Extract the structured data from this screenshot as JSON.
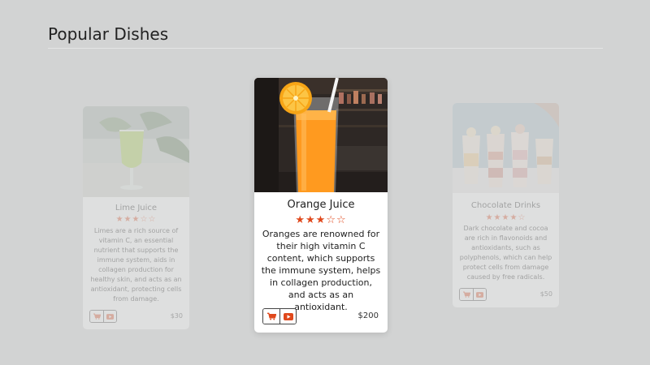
{
  "section": {
    "title": "Popular Dishes"
  },
  "accent_color": "#e0481c",
  "cards": [
    {
      "name": "Lime Juice",
      "rating": 3,
      "rating_max": 5,
      "stars_text": "★★★☆☆",
      "description": "Limes are a rich source of vitamin C, an essential nutrient that supports the immune system, aids in collagen production for healthy skin, and acts as an antioxidant, protecting cells from damage.",
      "price": "$30",
      "buttons": [
        "cart-icon",
        "video-icon"
      ]
    },
    {
      "name": "Orange Juice",
      "rating": 3,
      "rating_max": 5,
      "stars_text": "★★★☆☆",
      "description": "Oranges are renowned for their high vitamin C content, which supports the immune system, helps in collagen production, and acts as an antioxidant.",
      "price": "$200",
      "buttons": [
        "cart-icon",
        "video-icon"
      ]
    },
    {
      "name": "Chocolate Drinks",
      "rating": 4,
      "rating_max": 5,
      "stars_text": "★★★★☆",
      "description": "Dark chocolate and cocoa are rich in flavonoids and antioxidants, such as polyphenols, which can help protect cells from damage caused by free radicals.",
      "price": "$50",
      "buttons": [
        "cart-icon",
        "video-icon"
      ]
    }
  ]
}
